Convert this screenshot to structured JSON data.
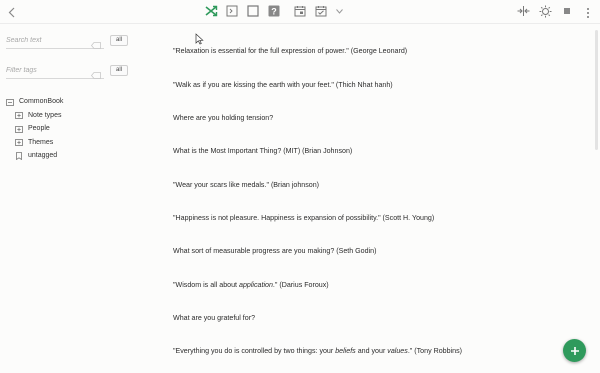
{
  "toolbar": {
    "icons": [
      "back-arrow-icon",
      "shuffle-icon",
      "note-icon",
      "page-icon",
      "help-icon",
      "calendar-icon",
      "calendar-check-icon",
      "chevron-down-icon",
      "split-view-icon",
      "brightness-icon",
      "stop-icon",
      "more-icon"
    ],
    "accent": "#2f9a5c"
  },
  "sidebar": {
    "search": {
      "placeholder": "Search text",
      "all_label": "all"
    },
    "filter": {
      "placeholder": "Filter tags",
      "all_label": "all"
    },
    "tree": {
      "root": "CommonBook",
      "children": [
        "Note types",
        "People",
        "Themes",
        "untagged"
      ]
    }
  },
  "notes": [
    {
      "text": "\"Relaxation is essential for the full expression of power.\" (George Leonard)"
    },
    {
      "text": "\"Walk as if you are kissing the earth with your feet.\" (Thich Nhat hanh)"
    },
    {
      "text": "Where are you holding tension?"
    },
    {
      "text": "What is the Most Important Thing? (MIT) (Brian Johnson)"
    },
    {
      "text": "\"Wear your scars like medals.\" (Brian johnson)"
    },
    {
      "text": "\"Happiness is not pleasure. Happiness is expansion of possibility.\" (Scott H. Young)"
    },
    {
      "text": "What sort of measurable progress are you making? (Seth Godin)"
    },
    {
      "pre": "\"Wisdom is all about ",
      "em": "application",
      "post": ".\" (Darius Foroux)"
    },
    {
      "text": "What are you grateful for?"
    },
    {
      "pre": "\"Everything you do is controlled by two things: your ",
      "em": "beliefs",
      "mid": " and your ",
      "em2": "values",
      "post": ".\" (Tony Robbins)"
    }
  ],
  "fab": {
    "icon": "plus-icon",
    "color": "#2f9a5c"
  }
}
